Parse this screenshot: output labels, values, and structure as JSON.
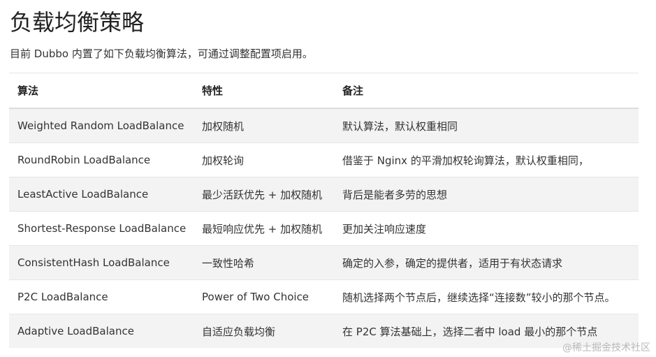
{
  "title": "负载均衡策略",
  "intro": "目前 Dubbo 内置了如下负载均衡算法，可通过调整配置项启用。",
  "table": {
    "headers": [
      "算法",
      "特性",
      "备注"
    ],
    "rows": [
      [
        "Weighted Random LoadBalance",
        "加权随机",
        "默认算法，默认权重相同"
      ],
      [
        "RoundRobin LoadBalance",
        "加权轮询",
        "借鉴于 Nginx 的平滑加权轮询算法，默认权重相同，"
      ],
      [
        "LeastActive LoadBalance",
        "最少活跃优先 + 加权随机",
        "背后是能者多劳的思想"
      ],
      [
        "Shortest-Response LoadBalance",
        "最短响应优先 + 加权随机",
        "更加关注响应速度"
      ],
      [
        "ConsistentHash LoadBalance",
        "一致性哈希",
        "确定的入参，确定的提供者，适用于有状态请求"
      ],
      [
        "P2C LoadBalance",
        "Power of Two Choice",
        "随机选择两个节点后，继续选择“连接数”较小的那个节点。"
      ],
      [
        "Adaptive LoadBalance",
        "自适应负载均衡",
        "在 P2C 算法基础上，选择二者中 load 最小的那个节点"
      ]
    ]
  },
  "watermark": "@稀土掘金技术社区"
}
